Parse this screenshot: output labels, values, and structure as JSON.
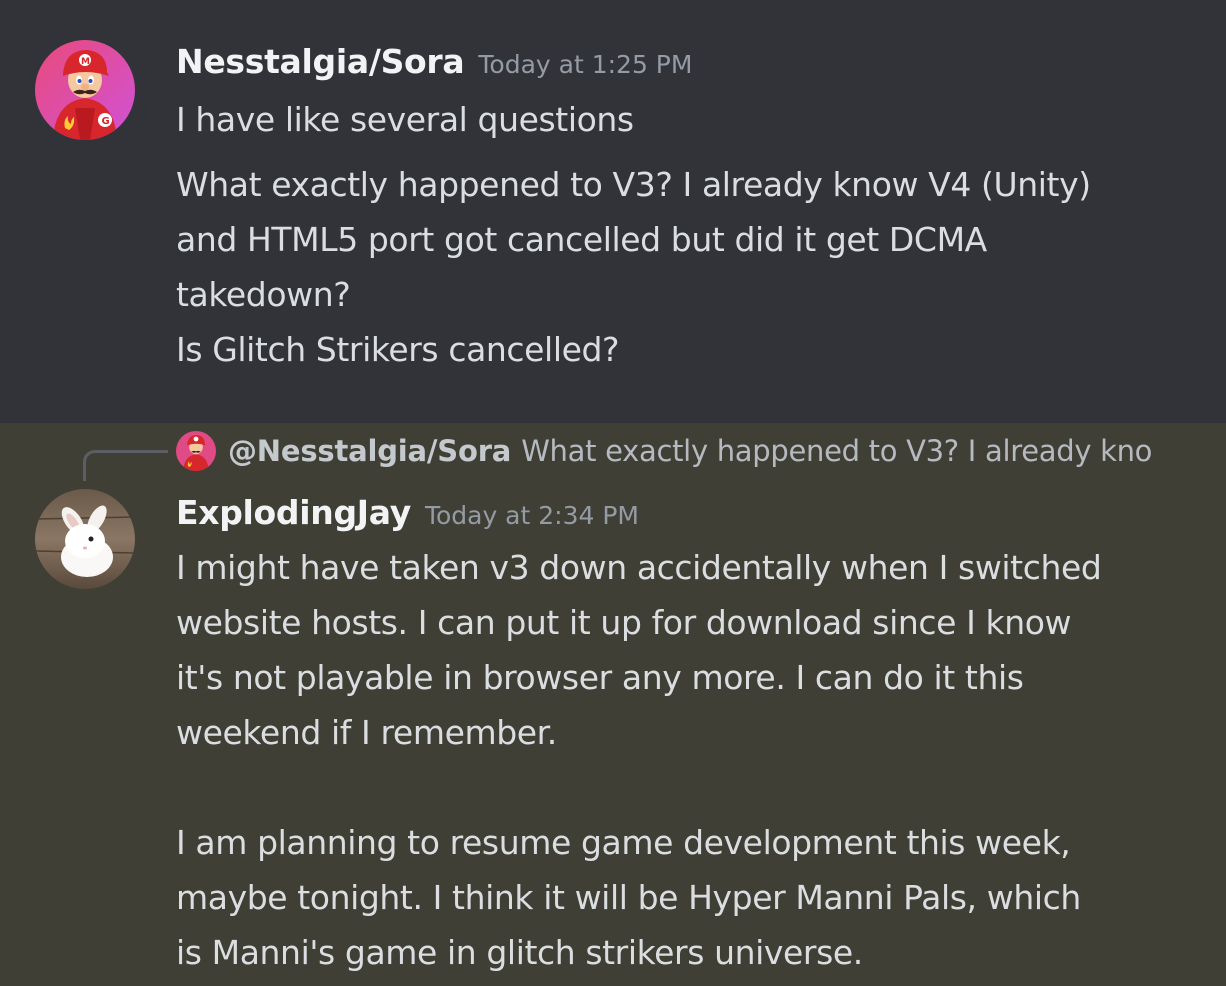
{
  "messages": [
    {
      "username": "Nesstalgia/Sora",
      "timestamp": "Today at 1:25 PM",
      "paragraphs": [
        "I have like several questions",
        "What exactly happened to V3? I already know V4 (Unity)\nand HTML5 port got cancelled but did it get DCMA\ntakedown?\nIs Glitch Strikers cancelled?"
      ]
    },
    {
      "reply": {
        "username": "@Nesstalgia/Sora",
        "text": "What exactly happened to V3? I already kno"
      },
      "username": "ExplodingJay",
      "timestamp": "Today at 2:34 PM",
      "paragraphs": [
        "I might have taken v3 down accidentally when I switched\nwebsite hosts. I can put it up for download since I know\nit's not playable in browser any more. I can do it this\nweekend if I remember.\n\nI am planning to resume game development this week,\nmaybe tonight. I think it will be Hyper Manni Pals, which\nis Manni's game in glitch strikers universe."
      ]
    }
  ],
  "colors": {
    "background_1": "#323339",
    "background_2": "#403f35",
    "username": "#f2f3f5",
    "timestamp": "#949ba4",
    "text": "#dbdee1"
  },
  "icons": {
    "avatar_1": "mario-avatar-icon",
    "avatar_2": "white-rabbit-avatar-icon"
  }
}
